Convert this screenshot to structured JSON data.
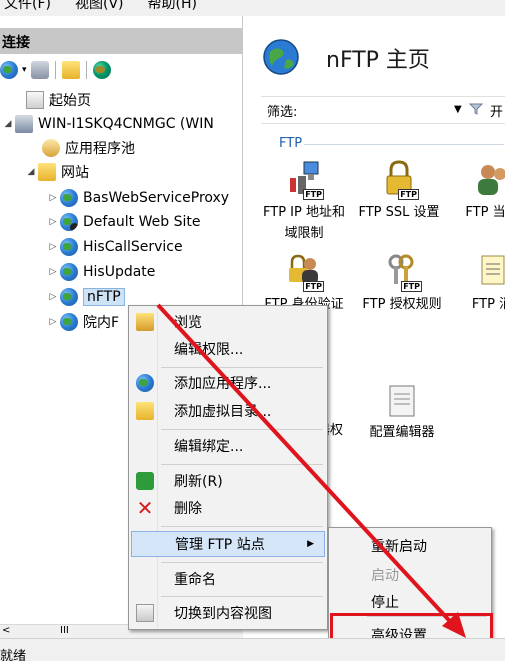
{
  "menubar": {
    "items": [
      "文件(F)",
      "视图(V)",
      "帮助(H)"
    ]
  },
  "left_panel": {
    "header": "连接",
    "tree": {
      "start_page": "起始页",
      "server": "WIN-I1SKQ4CNMGC (WIN",
      "app_pools": "应用程序池",
      "sites": "网站",
      "site_list": [
        "BasWebServiceProxy",
        "Default Web Site",
        "HisCallService",
        "HisUpdate",
        "nFTP",
        "院内F"
      ]
    },
    "scroll_thumb": "III"
  },
  "right_panel": {
    "title": "nFTP 主页",
    "filter_label": "筛选:",
    "filter_go": "开",
    "group": "FTP",
    "features": [
      {
        "label": "FTP IP 地址和域限制"
      },
      {
        "label": "FTP SSL 设置"
      },
      {
        "label": "FTP 当话"
      },
      {
        "label": "FTP 身份验证"
      },
      {
        "label": "FTP 授权规则"
      },
      {
        "label": "FTP 消"
      }
    ],
    "mgmt_features": [
      {
        "label": "器权"
      },
      {
        "label": "配置编辑器"
      }
    ]
  },
  "context_menu": {
    "items": [
      {
        "label": "浏览"
      },
      {
        "label": "编辑权限..."
      },
      {
        "label": "添加应用程序..."
      },
      {
        "label": "添加虚拟目录..."
      },
      {
        "label": "编辑绑定..."
      },
      {
        "label": "刷新(R)"
      },
      {
        "label": "删除"
      },
      {
        "label": "管理 FTP 站点"
      },
      {
        "label": "重命名"
      },
      {
        "label": "切换到内容视图"
      }
    ]
  },
  "submenu": {
    "items": [
      {
        "label": "重新启动",
        "enabled": true
      },
      {
        "label": "启动",
        "enabled": false
      },
      {
        "label": "停止",
        "enabled": true
      },
      {
        "label": "高级设置...",
        "enabled": true
      }
    ]
  },
  "status": {
    "text": "就绪"
  },
  "colors": {
    "annotation": "#e0141c",
    "highlight": "#d5e6f8",
    "link_blue": "#1f5fb0"
  }
}
